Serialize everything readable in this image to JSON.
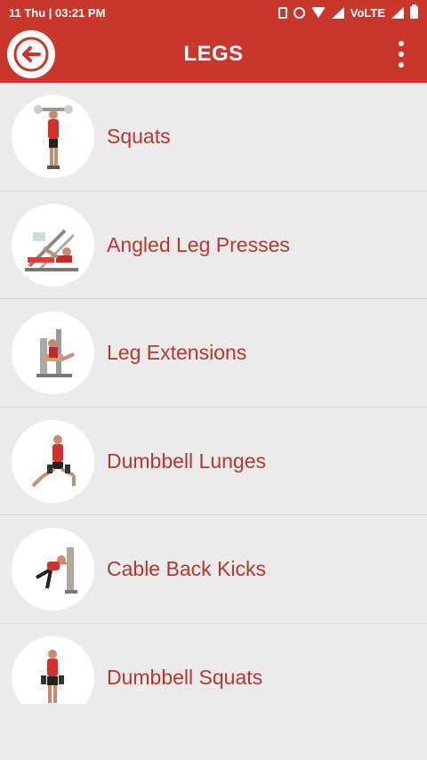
{
  "status_bar": {
    "time": "11 Thu  |  03:21 PM",
    "network": "VoLTE"
  },
  "app_bar": {
    "title": "LEGS",
    "back_icon": "back-arrow-icon",
    "menu_icon": "more-vert-icon"
  },
  "colors": {
    "primary": "#c9372c",
    "label": "#b8372e",
    "background": "#ebebeb"
  },
  "exercises": [
    {
      "label": "Squats"
    },
    {
      "label": "Angled Leg Presses"
    },
    {
      "label": "Leg Extensions"
    },
    {
      "label": "Dumbbell Lunges"
    },
    {
      "label": "Cable Back Kicks"
    },
    {
      "label": "Dumbbell Squats"
    }
  ]
}
